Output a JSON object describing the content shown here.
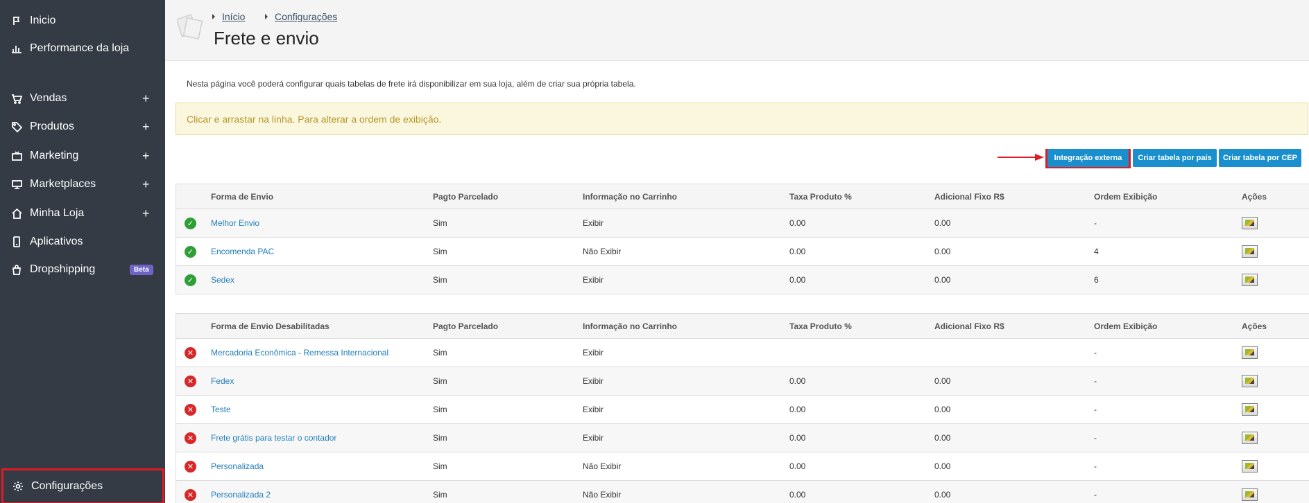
{
  "sidebar": {
    "items": [
      {
        "label": "Inicio",
        "icon": "flag-icon"
      },
      {
        "label": "Performance da loja",
        "icon": "bar-chart-icon"
      },
      {
        "label": "Vendas",
        "icon": "cart-icon",
        "expand": "+"
      },
      {
        "label": "Produtos",
        "icon": "tag-icon",
        "expand": "+"
      },
      {
        "label": "Marketing",
        "icon": "tv-icon",
        "expand": "+"
      },
      {
        "label": "Marketplaces",
        "icon": "monitor-icon",
        "expand": "+"
      },
      {
        "label": "Minha Loja",
        "icon": "home-icon",
        "expand": "+"
      },
      {
        "label": "Aplicativos",
        "icon": "phone-icon"
      },
      {
        "label": "Dropshipping",
        "icon": "bag-icon",
        "badge": "Beta"
      }
    ],
    "settings": {
      "label": "Configurações",
      "icon": "gear-icon"
    }
  },
  "breadcrumb": {
    "home": "Início",
    "current": "Configurações"
  },
  "page": {
    "title": "Frete e envio",
    "intro": "Nesta página você poderá configurar quais tabelas de frete irá disponibilizar em sua loja, além de criar sua própria tabela.",
    "alert": "Clicar e arrastar na linha. Para alterar a ordem de exibição."
  },
  "actions": {
    "external": "Integração externa",
    "by_country": "Criar tabela por país",
    "by_cep": "Criar tabela por CEP"
  },
  "enabled_table": {
    "headers": [
      "Forma de Envio",
      "Pagto Parcelado",
      "Informação no Carrinho",
      "Taxa Produto %",
      "Adicional Fixo R$",
      "Ordem Exibição",
      "Ações"
    ],
    "rows": [
      {
        "name": "Melhor Envio",
        "parc": "Sim",
        "info": "Exibir",
        "taxa": "0.00",
        "adic": "0.00",
        "ordem": "-"
      },
      {
        "name": "Encomenda PAC",
        "parc": "Sim",
        "info": "Não Exibir",
        "taxa": "0.00",
        "adic": "0.00",
        "ordem": "4"
      },
      {
        "name": "Sedex",
        "parc": "Sim",
        "info": "Exibir",
        "taxa": "0.00",
        "adic": "0.00",
        "ordem": "6"
      }
    ]
  },
  "disabled_table": {
    "headers": [
      "Forma de Envio Desabilitadas",
      "Pagto Parcelado",
      "Informação no Carrinho",
      "Taxa Produto %",
      "Adicional Fixo R$",
      "Ordem Exibição",
      "Ações"
    ],
    "rows": [
      {
        "name": "Mercadoria Econômica - Remessa Internacional",
        "parc": "Sim",
        "info": "Exibir",
        "taxa": "",
        "adic": "",
        "ordem": "-"
      },
      {
        "name": "Fedex",
        "parc": "Sim",
        "info": "Exibir",
        "taxa": "0.00",
        "adic": "0.00",
        "ordem": "-"
      },
      {
        "name": "Teste",
        "parc": "Sim",
        "info": "Exibir",
        "taxa": "0.00",
        "adic": "0.00",
        "ordem": "-"
      },
      {
        "name": "Frete grátis para testar o contador",
        "parc": "Sim",
        "info": "Exibir",
        "taxa": "0.00",
        "adic": "0.00",
        "ordem": "-"
      },
      {
        "name": "Personalizada",
        "parc": "Sim",
        "info": "Não Exibir",
        "taxa": "0.00",
        "adic": "0.00",
        "ordem": "-"
      },
      {
        "name": "Personalizada 2",
        "parc": "Sim",
        "info": "Não Exibir",
        "taxa": "0.00",
        "adic": "0.00",
        "ordem": "-"
      }
    ]
  },
  "colors": {
    "sidebar": "#343b45",
    "primary_button": "#1a8fce",
    "highlight": "#e01b24",
    "link": "#1f7dba"
  }
}
